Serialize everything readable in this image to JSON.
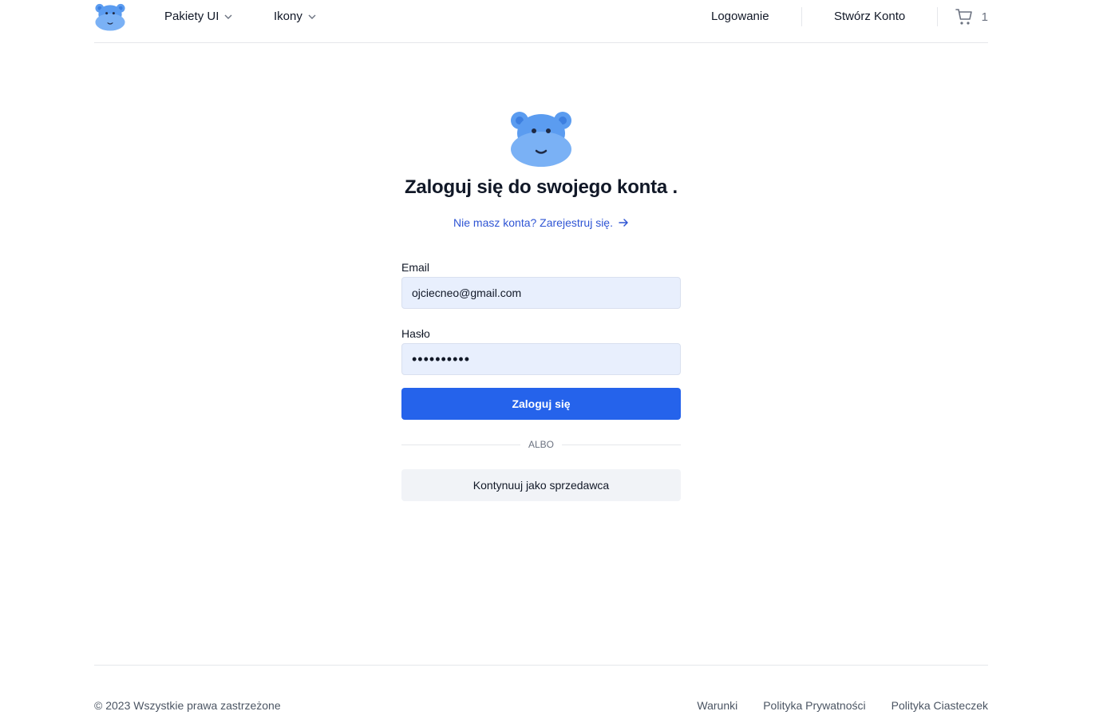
{
  "header": {
    "nav": [
      {
        "label": "Pakiety UI"
      },
      {
        "label": "Ikony"
      }
    ],
    "login_label": "Logowanie",
    "signup_label": "Stwórz Konto",
    "cart_count": "1"
  },
  "login": {
    "title": "Zaloguj się do swojego konta .",
    "signup_prompt": "Nie masz konta? Zarejestruj się.",
    "email_label": "Email",
    "email_value": "ojciecneo@gmail.com",
    "password_label": "Hasło",
    "password_mask": "••••••••••",
    "submit_label": "Zaloguj się",
    "or_label": "ALBO",
    "seller_label": "Kontynuuj jako sprzedawca"
  },
  "footer": {
    "copyright": "© 2023 Wszystkie prawa zastrzeżone",
    "links": [
      {
        "label": "Warunki"
      },
      {
        "label": "Polityka Prywatności"
      },
      {
        "label": "Polityka Ciasteczek"
      }
    ]
  },
  "colors": {
    "accent": "#2563eb",
    "link": "#2f55d4",
    "input_bg": "#e8effd",
    "mascot": "#5b9cf0"
  },
  "icons": {
    "logo": "hippo-logo-icon",
    "dropdown": "chevron-down-icon",
    "cart": "cart-icon",
    "arrow": "arrow-right-icon"
  }
}
